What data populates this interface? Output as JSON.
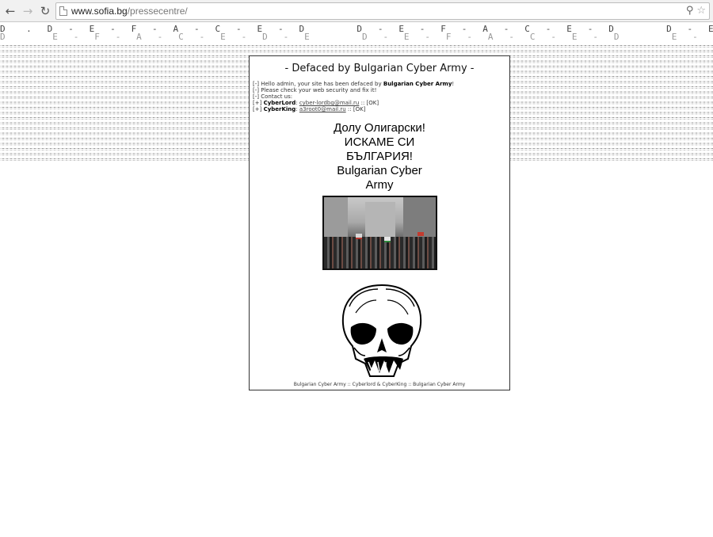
{
  "browser": {
    "back_glyph": "←",
    "forward_glyph": "→",
    "reload_glyph": "↻",
    "url_host": "www.sofia.bg",
    "url_path": "/pressecentre/",
    "zoom_glyph": "⚲",
    "star_glyph": "☆"
  },
  "background": {
    "deface_text": "D    .   D   -   E   -   F   -   A   -   C   -   E   -   D          D   -   E   -   F   -   A   -   C   -   E   -   D          D   -   E   -   F   -   A   -   C   -   E   -   D",
    "deface_text_shadow": "D         E   -   F   -   A   -   C   -   E   -   D   -   E          D   -   E   -   F   -   A   -   C   -   E   -   D          E   -   F   -   A   -   C   -   E   -   D"
  },
  "panel": {
    "title": "- Defaced by Bulgarian Cyber Army -",
    "info_line1_prefix": "[-] Hello admin, your site has been defaced by ",
    "info_line1_bold": "Bulgarian Cyber Army",
    "info_line1_suffix": "!",
    "info_line2": "[-] Please check your web security and fix it!",
    "info_line3": "[-] Contact us:",
    "contact1_prefix": "[+] ",
    "contact1_name": "CyberLord",
    "contact1_sep": ": ",
    "contact1_email": "cyber-lordbg@mail.ru",
    "contact1_suffix": " :: [OK]",
    "contact2_prefix": "[+] ",
    "contact2_name": "CyberKing",
    "contact2_sep": ": ",
    "contact2_email": "a3root0@mail.ru",
    "contact2_suffix": " :: [OK]",
    "slogan_line1": "Долу Олигарски!",
    "slogan_line2": "ИСКАМЕ СИ",
    "slogan_line3": "БЪЛГАРИЯ!",
    "slogan_line4": "Bulgarian Cyber",
    "slogan_line5": "Army",
    "footer": "Bulgarian Cyber Army :: Cyberlord & CyberKing :: Bulgarian Cyber Army"
  }
}
